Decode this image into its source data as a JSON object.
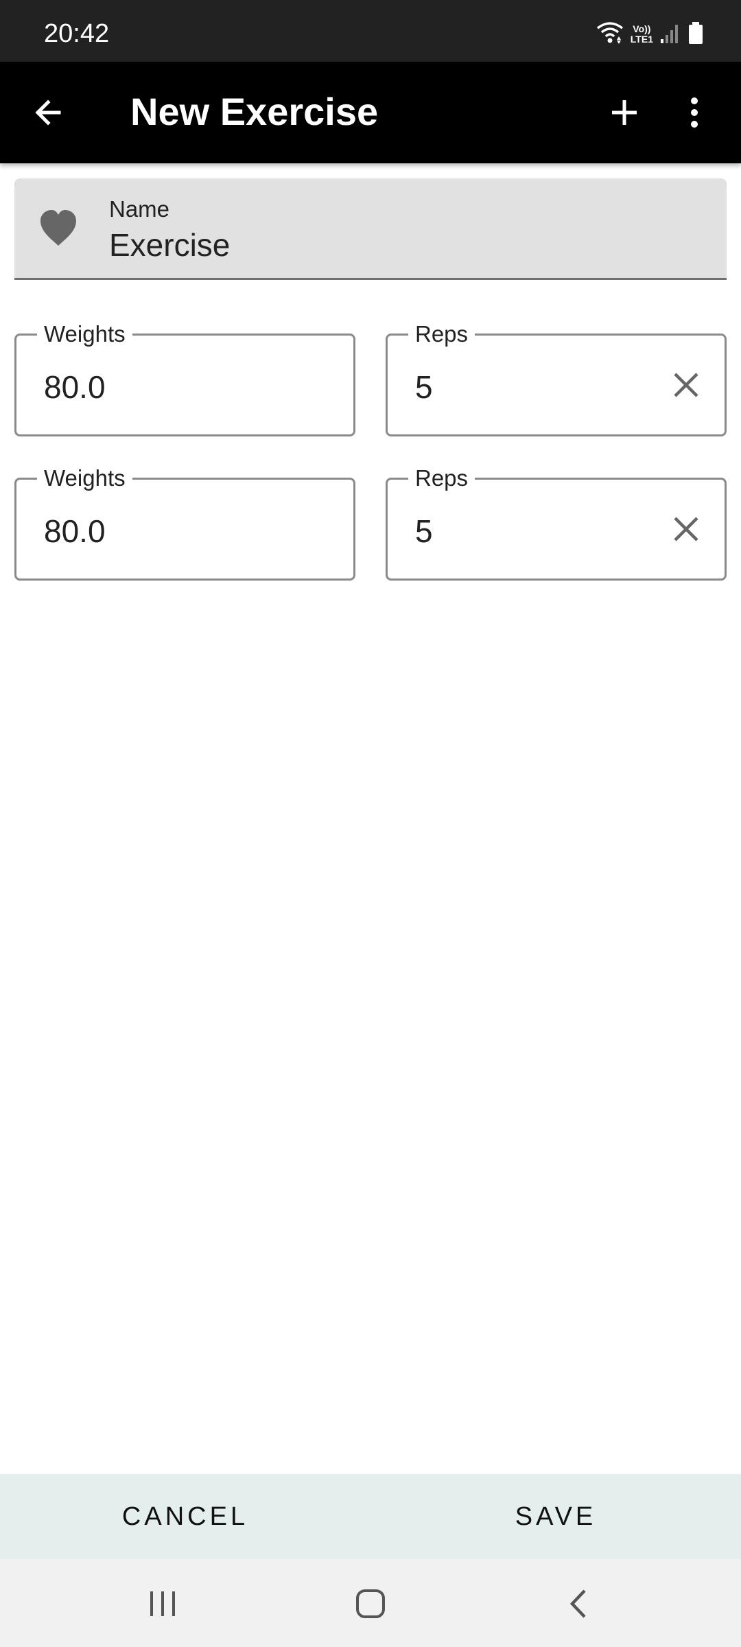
{
  "status_bar": {
    "time": "20:42",
    "network_top": "Vo))",
    "network_bottom": "LTE1",
    "icons": [
      "wifi-icon",
      "signal-icon",
      "battery-icon"
    ]
  },
  "app_bar": {
    "title": "New Exercise",
    "icons": [
      "back-arrow-icon",
      "plus-icon",
      "more-vert-icon"
    ]
  },
  "name_field": {
    "label": "Name",
    "value": "Exercise",
    "icon": "heart-icon"
  },
  "sets": [
    {
      "weights_label": "Weights",
      "weights_value": "80.0",
      "reps_label": "Reps",
      "reps_value": "5"
    },
    {
      "weights_label": "Weights",
      "weights_value": "80.0",
      "reps_label": "Reps",
      "reps_value": "5"
    }
  ],
  "actions": {
    "cancel_label": "CANCEL",
    "save_label": "SAVE"
  },
  "nav_bar": {
    "icons": [
      "recents-icon",
      "home-icon",
      "back-icon"
    ]
  },
  "colors": {
    "status_bar_bg": "#222222",
    "app_bar_bg": "#000000",
    "name_field_bg": "#e1e1e1",
    "action_bar_bg": "#e4eeec",
    "nav_bar_bg": "#f1f1f1",
    "field_border": "#8a8a8a",
    "icon_gray": "#666666"
  }
}
